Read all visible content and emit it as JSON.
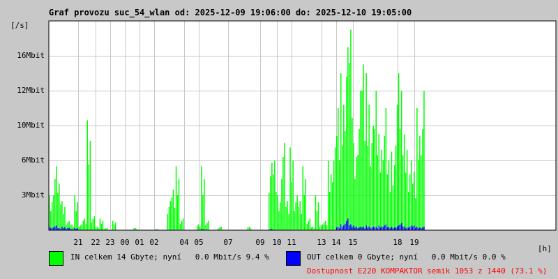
{
  "chart_data": {
    "type": "bar",
    "title": "Graf provozu suc_54_wlan od: 2025-12-09 19:06:00 do: 2025-12-10 19:05:00",
    "ylabel": "[/s]",
    "xlabel": "[h]",
    "y_ticks": [
      {
        "label": "3Mbit",
        "value": 3
      },
      {
        "label": "6Mbit",
        "value": 6
      },
      {
        "label": "10Mbit",
        "value": 10
      },
      {
        "label": "12Mbit",
        "value": 12
      },
      {
        "label": "16Mbit",
        "value": 16
      }
    ],
    "x_ticks": [
      {
        "label": "21",
        "hour_offset": 1.4
      },
      {
        "label": "22",
        "hour_offset": 2.2
      },
      {
        "label": "23",
        "hour_offset": 2.9
      },
      {
        "label": "00",
        "hour_offset": 3.6
      },
      {
        "label": "01",
        "hour_offset": 4.3
      },
      {
        "label": "02",
        "hour_offset": 5.0
      },
      {
        "label": "04",
        "hour_offset": 6.4
      },
      {
        "label": "05",
        "hour_offset": 7.1
      },
      {
        "label": "07",
        "hour_offset": 8.5
      },
      {
        "label": "09",
        "hour_offset": 10.0
      },
      {
        "label": "10",
        "hour_offset": 10.8
      },
      {
        "label": "11",
        "hour_offset": 11.5
      },
      {
        "label": "13",
        "hour_offset": 12.9
      },
      {
        "label": "14",
        "hour_offset": 13.6
      },
      {
        "label": "15",
        "hour_offset": 14.4
      },
      {
        "label": "18",
        "hour_offset": 16.5
      },
      {
        "label": "19",
        "hour_offset": 17.3
      }
    ],
    "hours_span": 24,
    "bin_minutes": 12,
    "series": [
      {
        "name": "IN",
        "color": "#00ff00",
        "values_mbit": [
          3,
          5.5,
          4,
          2.5,
          0.8,
          0.5,
          3,
          0.5,
          1,
          10.3,
          1.2,
          0.3,
          1,
          0.2,
          0,
          0.8,
          0,
          0,
          0,
          0,
          0.2,
          0,
          0,
          0,
          0,
          0.1,
          0,
          0,
          2.5,
          3.5,
          5.5,
          1,
          0,
          0,
          0,
          0.5,
          5.5,
          0.8,
          0,
          0,
          0.3,
          0,
          0,
          0,
          0,
          0,
          0,
          0.3,
          0,
          0,
          0,
          0,
          5.8,
          6,
          3,
          8,
          2.5,
          7.5,
          3,
          2.5,
          5.5,
          1,
          0.3,
          3,
          0.5,
          0.8,
          6,
          7.5,
          11,
          14,
          17,
          19,
          8,
          12,
          15,
          14,
          10,
          12,
          9,
          11,
          6,
          7,
          14,
          12,
          9,
          6,
          5,
          11,
          12
        ]
      },
      {
        "name": "OUT",
        "color": "#0000ff",
        "values_mbit": [
          0.3,
          0.4,
          0.2,
          0.3,
          0.2,
          0.1,
          0.2,
          0,
          0,
          0,
          0,
          0,
          0,
          0,
          0,
          0,
          0,
          0,
          0,
          0,
          0,
          0,
          0,
          0,
          0,
          0,
          0,
          0,
          0,
          0,
          0,
          0,
          0,
          0,
          0,
          0,
          0.1,
          0,
          0,
          0,
          0,
          0,
          0,
          0,
          0,
          0,
          0,
          0,
          0,
          0,
          0,
          0,
          0.1,
          0,
          0,
          0,
          0,
          0,
          0,
          0,
          0,
          0,
          0,
          0,
          0,
          0,
          0,
          0,
          0.3,
          0.5,
          1,
          0.5,
          0.4,
          0.3,
          0.3,
          0.4,
          0.3,
          0.3,
          0.4,
          0.5,
          0.3,
          0.3,
          0.4,
          0.6,
          0.3,
          0.4,
          0.4,
          0.3,
          0.3
        ]
      }
    ]
  },
  "legend": {
    "in_text": "IN celkem 14 Gbyte; nyní   0.0 Mbit/s 9.4 %",
    "out_text": "OUT celkem 0 Gbyte; nyní   0.0 Mbit/s 0.0 %",
    "availability": "Dostupnost E220 KOMPAKTOR semik 1053 z 1440 (73.1 %)",
    "in_color": "#00ff00",
    "out_color": "#0000ff",
    "availability_color": "#ff0000"
  }
}
